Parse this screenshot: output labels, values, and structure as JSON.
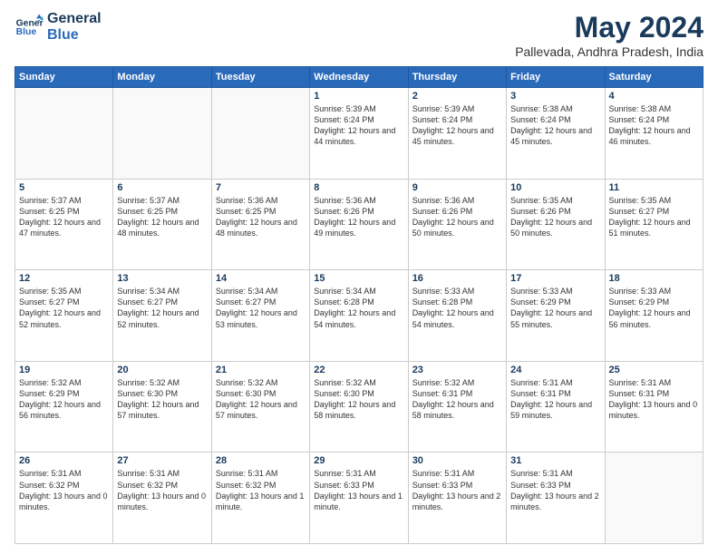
{
  "logo": {
    "line1": "General",
    "line2": "Blue"
  },
  "title": "May 2024",
  "location": "Pallevada, Andhra Pradesh, India",
  "weekdays": [
    "Sunday",
    "Monday",
    "Tuesday",
    "Wednesday",
    "Thursday",
    "Friday",
    "Saturday"
  ],
  "weeks": [
    [
      {
        "day": "",
        "text": ""
      },
      {
        "day": "",
        "text": ""
      },
      {
        "day": "",
        "text": ""
      },
      {
        "day": "1",
        "text": "Sunrise: 5:39 AM\nSunset: 6:24 PM\nDaylight: 12 hours\nand 44 minutes."
      },
      {
        "day": "2",
        "text": "Sunrise: 5:39 AM\nSunset: 6:24 PM\nDaylight: 12 hours\nand 45 minutes."
      },
      {
        "day": "3",
        "text": "Sunrise: 5:38 AM\nSunset: 6:24 PM\nDaylight: 12 hours\nand 45 minutes."
      },
      {
        "day": "4",
        "text": "Sunrise: 5:38 AM\nSunset: 6:24 PM\nDaylight: 12 hours\nand 46 minutes."
      }
    ],
    [
      {
        "day": "5",
        "text": "Sunrise: 5:37 AM\nSunset: 6:25 PM\nDaylight: 12 hours\nand 47 minutes."
      },
      {
        "day": "6",
        "text": "Sunrise: 5:37 AM\nSunset: 6:25 PM\nDaylight: 12 hours\nand 48 minutes."
      },
      {
        "day": "7",
        "text": "Sunrise: 5:36 AM\nSunset: 6:25 PM\nDaylight: 12 hours\nand 48 minutes."
      },
      {
        "day": "8",
        "text": "Sunrise: 5:36 AM\nSunset: 6:26 PM\nDaylight: 12 hours\nand 49 minutes."
      },
      {
        "day": "9",
        "text": "Sunrise: 5:36 AM\nSunset: 6:26 PM\nDaylight: 12 hours\nand 50 minutes."
      },
      {
        "day": "10",
        "text": "Sunrise: 5:35 AM\nSunset: 6:26 PM\nDaylight: 12 hours\nand 50 minutes."
      },
      {
        "day": "11",
        "text": "Sunrise: 5:35 AM\nSunset: 6:27 PM\nDaylight: 12 hours\nand 51 minutes."
      }
    ],
    [
      {
        "day": "12",
        "text": "Sunrise: 5:35 AM\nSunset: 6:27 PM\nDaylight: 12 hours\nand 52 minutes."
      },
      {
        "day": "13",
        "text": "Sunrise: 5:34 AM\nSunset: 6:27 PM\nDaylight: 12 hours\nand 52 minutes."
      },
      {
        "day": "14",
        "text": "Sunrise: 5:34 AM\nSunset: 6:27 PM\nDaylight: 12 hours\nand 53 minutes."
      },
      {
        "day": "15",
        "text": "Sunrise: 5:34 AM\nSunset: 6:28 PM\nDaylight: 12 hours\nand 54 minutes."
      },
      {
        "day": "16",
        "text": "Sunrise: 5:33 AM\nSunset: 6:28 PM\nDaylight: 12 hours\nand 54 minutes."
      },
      {
        "day": "17",
        "text": "Sunrise: 5:33 AM\nSunset: 6:29 PM\nDaylight: 12 hours\nand 55 minutes."
      },
      {
        "day": "18",
        "text": "Sunrise: 5:33 AM\nSunset: 6:29 PM\nDaylight: 12 hours\nand 56 minutes."
      }
    ],
    [
      {
        "day": "19",
        "text": "Sunrise: 5:32 AM\nSunset: 6:29 PM\nDaylight: 12 hours\nand 56 minutes."
      },
      {
        "day": "20",
        "text": "Sunrise: 5:32 AM\nSunset: 6:30 PM\nDaylight: 12 hours\nand 57 minutes."
      },
      {
        "day": "21",
        "text": "Sunrise: 5:32 AM\nSunset: 6:30 PM\nDaylight: 12 hours\nand 57 minutes."
      },
      {
        "day": "22",
        "text": "Sunrise: 5:32 AM\nSunset: 6:30 PM\nDaylight: 12 hours\nand 58 minutes."
      },
      {
        "day": "23",
        "text": "Sunrise: 5:32 AM\nSunset: 6:31 PM\nDaylight: 12 hours\nand 58 minutes."
      },
      {
        "day": "24",
        "text": "Sunrise: 5:31 AM\nSunset: 6:31 PM\nDaylight: 12 hours\nand 59 minutes."
      },
      {
        "day": "25",
        "text": "Sunrise: 5:31 AM\nSunset: 6:31 PM\nDaylight: 13 hours\nand 0 minutes."
      }
    ],
    [
      {
        "day": "26",
        "text": "Sunrise: 5:31 AM\nSunset: 6:32 PM\nDaylight: 13 hours\nand 0 minutes."
      },
      {
        "day": "27",
        "text": "Sunrise: 5:31 AM\nSunset: 6:32 PM\nDaylight: 13 hours\nand 0 minutes."
      },
      {
        "day": "28",
        "text": "Sunrise: 5:31 AM\nSunset: 6:32 PM\nDaylight: 13 hours\nand 1 minute."
      },
      {
        "day": "29",
        "text": "Sunrise: 5:31 AM\nSunset: 6:33 PM\nDaylight: 13 hours\nand 1 minute."
      },
      {
        "day": "30",
        "text": "Sunrise: 5:31 AM\nSunset: 6:33 PM\nDaylight: 13 hours\nand 2 minutes."
      },
      {
        "day": "31",
        "text": "Sunrise: 5:31 AM\nSunset: 6:33 PM\nDaylight: 13 hours\nand 2 minutes."
      },
      {
        "day": "",
        "text": ""
      }
    ]
  ]
}
